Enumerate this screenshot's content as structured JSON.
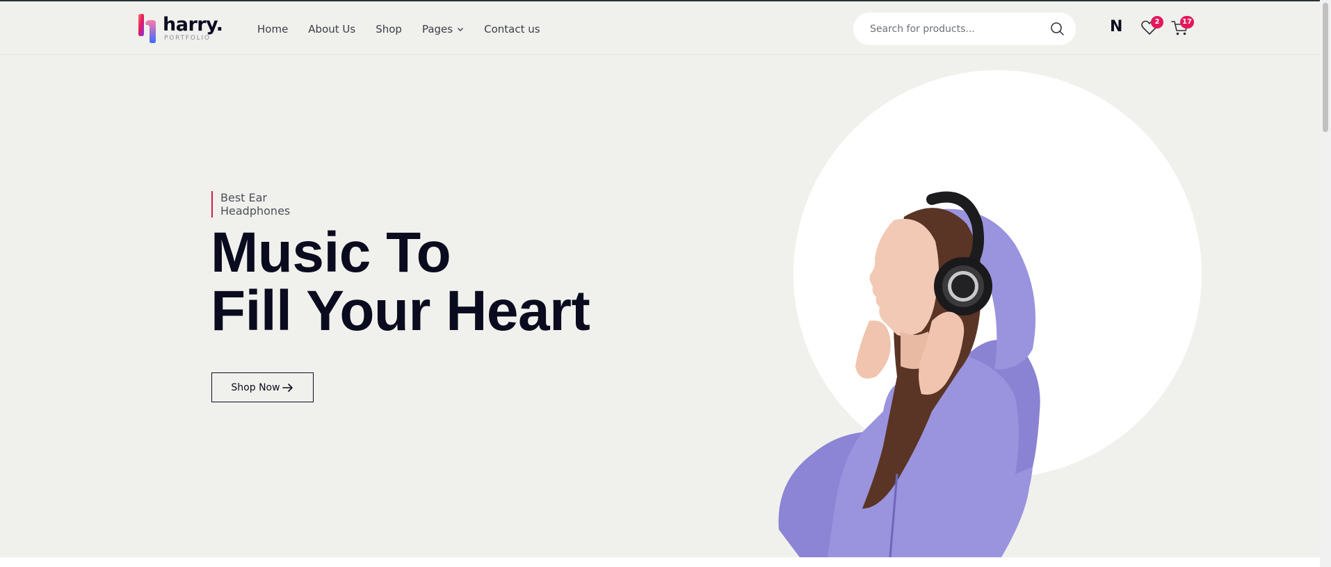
{
  "brand": {
    "name": "harry.",
    "tagline": "PORTFOLIO",
    "colors": {
      "accent": "#e4175c",
      "dark": "#0b0b1f",
      "background": "#f0f1ec"
    }
  },
  "nav": {
    "items": [
      {
        "label": "Home"
      },
      {
        "label": "About Us"
      },
      {
        "label": "Shop"
      },
      {
        "label": "Pages",
        "has_dropdown": true
      },
      {
        "label": "Contact us"
      }
    ]
  },
  "search": {
    "placeholder": "Search for products...",
    "icon": "search-icon"
  },
  "header_icons": {
    "user_initial": "N",
    "wishlist_count": "2",
    "cart_count": "17"
  },
  "hero": {
    "eyebrow_line1": "Best Ear",
    "eyebrow_line2": "Headphones",
    "title_line1": "Music To",
    "title_line2": "Fill Your Heart",
    "cta_label": "Shop Now",
    "image": "woman-with-headphones-in-purple-hoodie"
  }
}
